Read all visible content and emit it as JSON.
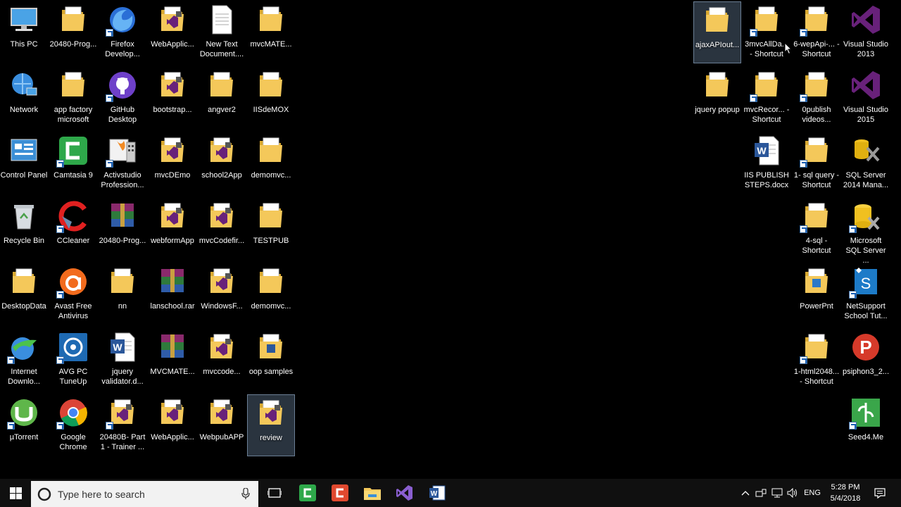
{
  "desktop": {
    "icons": [
      {
        "label": "This PC",
        "kind": "pc",
        "shortcut": false
      },
      {
        "label": "20480-Prog...",
        "kind": "folder",
        "shortcut": false
      },
      {
        "label": "Firefox Develop...",
        "kind": "firefox",
        "shortcut": true
      },
      {
        "label": "WebApplic...",
        "kind": "vsfolder",
        "shortcut": false
      },
      {
        "label": "New Text Document....",
        "kind": "textdoc",
        "shortcut": false
      },
      {
        "label": "mvcMATE...",
        "kind": "folder",
        "shortcut": false
      },
      {
        "label": "Network",
        "kind": "network",
        "shortcut": false
      },
      {
        "label": "app factory microsoft",
        "kind": "folder",
        "shortcut": false
      },
      {
        "label": "GitHub Desktop",
        "kind": "github",
        "shortcut": true
      },
      {
        "label": "bootstrap...",
        "kind": "vsfolder",
        "shortcut": false
      },
      {
        "label": "angver2",
        "kind": "folder",
        "shortcut": false
      },
      {
        "label": "IISdeMOX",
        "kind": "folder",
        "shortcut": false
      },
      {
        "label": "Control Panel",
        "kind": "controlpanel",
        "shortcut": false
      },
      {
        "label": "Camtasia 9",
        "kind": "camtasia",
        "shortcut": true
      },
      {
        "label": "Activstudio Profession...",
        "kind": "activstudio",
        "shortcut": true
      },
      {
        "label": "mvcDEmo",
        "kind": "vsfolder",
        "shortcut": false
      },
      {
        "label": "school2App",
        "kind": "vsfolder",
        "shortcut": false
      },
      {
        "label": "demomvc...",
        "kind": "folder",
        "shortcut": false
      },
      {
        "label": "Recycle Bin",
        "kind": "recycle",
        "shortcut": false
      },
      {
        "label": "CCleaner",
        "kind": "ccleaner",
        "shortcut": true
      },
      {
        "label": "20480-Prog...",
        "kind": "rar",
        "shortcut": false
      },
      {
        "label": "webformApp",
        "kind": "vsfolder",
        "shortcut": false
      },
      {
        "label": "mvcCodefir...",
        "kind": "vsfolder",
        "shortcut": false
      },
      {
        "label": "TESTPUB",
        "kind": "folder",
        "shortcut": false
      },
      {
        "label": "DesktopData",
        "kind": "folder",
        "shortcut": false
      },
      {
        "label": "Avast Free Antivirus",
        "kind": "avast",
        "shortcut": true
      },
      {
        "label": "nn",
        "kind": "folder",
        "shortcut": false
      },
      {
        "label": "lanschool.rar",
        "kind": "rar",
        "shortcut": false
      },
      {
        "label": "WindowsF...",
        "kind": "vsfolder",
        "shortcut": false
      },
      {
        "label": "demomvc...",
        "kind": "folder",
        "shortcut": false
      },
      {
        "label": "Internet Downlo...",
        "kind": "idm",
        "shortcut": true
      },
      {
        "label": "AVG PC TuneUp",
        "kind": "avg",
        "shortcut": true
      },
      {
        "label": "jquery validator.d...",
        "kind": "word",
        "shortcut": false
      },
      {
        "label": "MVCMATE...",
        "kind": "rar",
        "shortcut": false
      },
      {
        "label": "mvccode...",
        "kind": "vsfolder",
        "shortcut": false
      },
      {
        "label": "oop samples",
        "kind": "wordfolder",
        "shortcut": false
      },
      {
        "label": "µTorrent",
        "kind": "utorrent",
        "shortcut": true
      },
      {
        "label": "Google Chrome",
        "kind": "chrome",
        "shortcut": true
      },
      {
        "label": "20480B- Part 1 - Trainer ...",
        "kind": "vsfolder",
        "shortcut": true
      },
      {
        "label": "WebApplic...",
        "kind": "vsfolder",
        "shortcut": false
      },
      {
        "label": "WebpubAPP",
        "kind": "vsfolder",
        "shortcut": false
      },
      {
        "label": "review",
        "kind": "vsfolder",
        "shortcut": false,
        "selected": true
      },
      {
        "label": "ajaxAPIout...",
        "kind": "folder",
        "shortcut": false,
        "selected": true
      },
      {
        "label": "3mvcAllDa... - Shortcut",
        "kind": "folder",
        "shortcut": true
      },
      {
        "label": "6-wepApi-... - Shortcut",
        "kind": "folder",
        "shortcut": true
      },
      {
        "label": "Visual Studio 2013",
        "kind": "vs",
        "shortcut": false
      },
      {
        "label": "jquery popup",
        "kind": "folder",
        "shortcut": false
      },
      {
        "label": "mvcRecor... - Shortcut",
        "kind": "folder",
        "shortcut": true
      },
      {
        "label": "0publish videos...",
        "kind": "folder",
        "shortcut": true
      },
      {
        "label": "Visual Studio 2015",
        "kind": "vs",
        "shortcut": false
      },
      {
        "label": "IIS PUBLISH STEPS.docx",
        "kind": "word",
        "shortcut": false
      },
      {
        "label": "1- sql query - Shortcut",
        "kind": "folder",
        "shortcut": true
      },
      {
        "label": "SQL Server 2014 Mana...",
        "kind": "sqltools",
        "shortcut": false
      },
      {
        "label": "4-sql - Shortcut",
        "kind": "folder",
        "shortcut": true
      },
      {
        "label": "Microsoft SQL Server ...",
        "kind": "sqlserver",
        "shortcut": true
      },
      {
        "label": "PowerPnt",
        "kind": "pptfolder",
        "shortcut": false
      },
      {
        "label": "NetSupport School Tut...",
        "kind": "netsupport",
        "shortcut": true
      },
      {
        "label": "1-html2048... - Shortcut",
        "kind": "folder",
        "shortcut": true
      },
      {
        "label": "psiphon3_2...",
        "kind": "psiphon",
        "shortcut": false
      },
      {
        "label": "Seed4.Me",
        "kind": "seed",
        "shortcut": true
      }
    ]
  },
  "taskbar": {
    "search_placeholder": "Type here to search",
    "pinned": [
      "task-view",
      "camtasia-studio",
      "camtasia-recorder",
      "file-explorer",
      "visual-studio",
      "word"
    ],
    "tray": {
      "language": "ENG",
      "time": "5:28 PM",
      "date": "5/4/2018"
    }
  },
  "colors": {
    "folder": "#f4c85a",
    "folder_dark": "#d9a82e",
    "vs_purple": "#68217a",
    "taskbar": "#101010",
    "selection": "#4d6a8a"
  }
}
